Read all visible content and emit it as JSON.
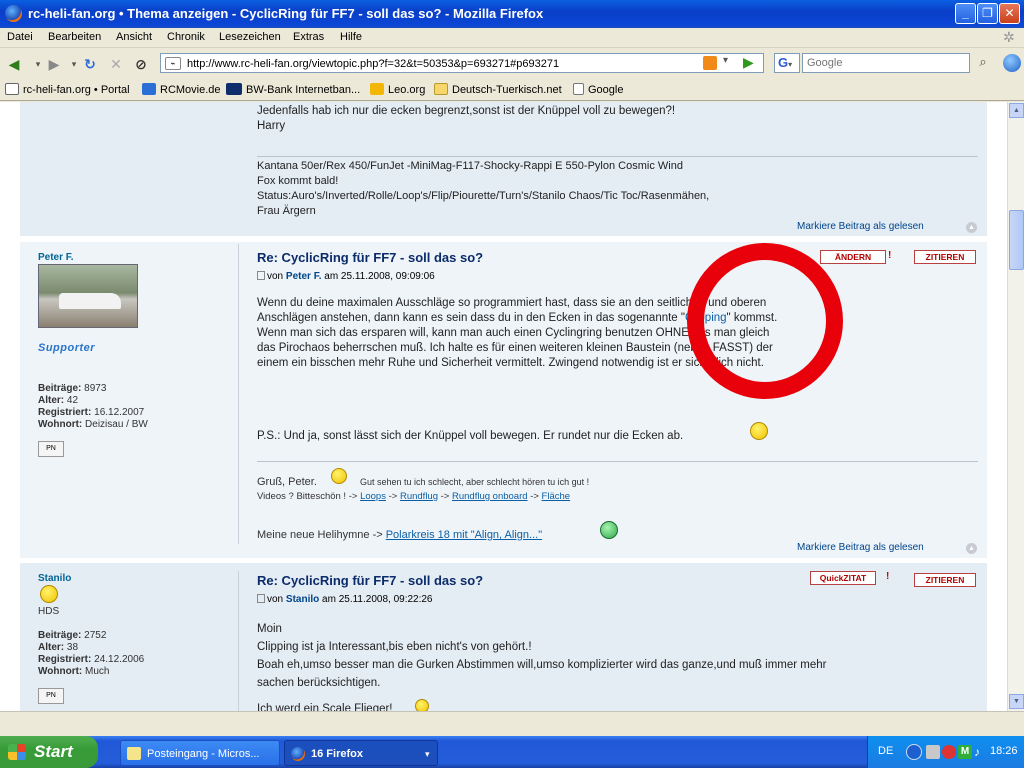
{
  "window": {
    "title": "rc-heli-fan.org • Thema anzeigen - CyclicRing für FF7 - soll das so? - Mozilla Firefox",
    "minimize_label": "_",
    "maximize_label": "❐",
    "close_label": "✕"
  },
  "menu": [
    "Datei",
    "Bearbeiten",
    "Ansicht",
    "Chronik",
    "Lesezeichen",
    "Extras",
    "Hilfe"
  ],
  "navigation": {
    "url": "http://www.rc-heli-fan.org/viewtopic.php?f=32&t=50353&p=693271#p693271",
    "search_engine": "G",
    "search_placeholder": "Google"
  },
  "bookmarks": [
    {
      "label": "rc-heli-fan.org • Portal",
      "icon": "heli-icon",
      "color": "#ffffff"
    },
    {
      "label": "RCMovie.de",
      "icon": "movie-icon",
      "color": "#2a6fd6"
    },
    {
      "label": "BW-Bank Internetban...",
      "icon": "bank-icon",
      "color": "#0d2d6b"
    },
    {
      "label": "Leo.org",
      "icon": "leo-icon",
      "color": "#f2b705"
    },
    {
      "label": "Deutsch-Tuerkisch.net",
      "icon": "folder-icon",
      "color": "#f7d66b"
    },
    {
      "label": "Google",
      "icon": "page-icon",
      "color": "#ffffff"
    }
  ],
  "first_post_tail": {
    "lines": [
      "Jedenfalls hab ich nur die ecken begrenzt,sonst ist der Knüppel voll zu bewegen?!",
      "Harry"
    ],
    "signature": [
      "Kantana 50er/Rex 450/FunJet -MiniMag-F117-Shocky-Rappi E 550-Pylon Cosmic Wind",
      "Fox kommt bald!",
      "Status:Auro's/Inverted/Rolle/Loop's/Flip/Piourette/Turn's/Stanilo Chaos/Tic Toc/Rasenmähen,",
      "Frau Ärgern"
    ],
    "mark_read": "Markiere Beitrag als gelesen"
  },
  "post_peter": {
    "username": "Peter F.",
    "rank_badge": "Supporter",
    "stats": {
      "beitraege": "8973",
      "alter": "42",
      "registriert": "16.12.2007",
      "wohnort": "Deizisau / BW"
    },
    "labels": {
      "beitraege": "Beiträge:",
      "alter": "Alter:",
      "registriert": "Registriert:",
      "wohnort": "Wohnort:"
    },
    "pm_label": "PN",
    "title": "Re: CyclicRing für FF7 - soll das so?",
    "meta_prefix": "von",
    "author": "Peter F.",
    "meta_date": "am 25.11.2008, 09:09:06",
    "buttons": {
      "edit": "ÄNDERN",
      "quote": "ZITIEREN"
    },
    "body": [
      "Wenn du deine maximalen Ausschläge so programmiert hast, dass sie an den seitlichen und oberen",
      "Anschlägen anstehen, dann kann es sein dass du in den Ecken in das sogenannte \"",
      "Wenn man sich das ersparen will, kann man auch einen Cyclingring benutzen OHNE das man gleich",
      "das Pirochaos beherrschen muß. Ich halte es für einen weiteren kleinen Baustein (neben FASST) der",
      "einem ein bisschen mehr Ruhe und Sicherheit vermittelt. Zwingend notwendig ist er sicherlich nicht."
    ],
    "clipping_word": "Clipping",
    "clipping_tail": "\" kommst.",
    "ps": "P.S.: Und ja, sonst lässt sich der Knüppel voll bewegen. Er rundet nur die Ecken ab.",
    "sig_greeting": "Gruß, Peter.",
    "sig_motto": "Gut sehen tu ich schlecht, aber schlecht hören tu ich gut !",
    "sig_videos_prefix": "Videos ? Bitteschön ! ->",
    "sig_links": [
      "Loops",
      "Rundflug",
      "Rundflug onboard",
      "Fläche"
    ],
    "sig_arrow": "->",
    "sig_hymn_prefix": "Meine neue Helihymne ->",
    "sig_hymn_link": "Polarkreis 18 mit \"Align, Align...\"",
    "mark_read": "Markiere Beitrag als gelesen"
  },
  "post_stanilo": {
    "username": "Stanilo",
    "rank": "HDS",
    "stats": {
      "beitraege": "2752",
      "alter": "38",
      "registriert": "24.12.2006",
      "wohnort": "Much"
    },
    "labels": {
      "beitraege": "Beiträge:",
      "alter": "Alter:",
      "registriert": "Registriert:",
      "wohnort": "Wohnort:"
    },
    "pm_label": "PN",
    "title": "Re: CyclicRing für FF7 - soll das so?",
    "meta_prefix": "von",
    "author": "Stanilo",
    "meta_date": "am 25.11.2008, 09:22:26",
    "buttons": {
      "quickquote": "QuickZITAT",
      "quote": "ZITIEREN"
    },
    "body": [
      "Moin",
      "Clipping ist ja Interessant,bis eben nicht's von gehört.!",
      "Boah eh,umso besser man die Gurken Abstimmen will,umso komplizierter wird das ganze,und muß immer mehr",
      "sachen berücksichtigen.",
      "Ich werd ein Scale Flieger!"
    ]
  },
  "taskbar": {
    "start_label": "Start",
    "items": [
      {
        "label": "Posteingang - Micros...",
        "icon": "outlook-icon"
      },
      {
        "label": "16 Firefox",
        "icon": "firefox-icon"
      }
    ],
    "language": "DE",
    "clock": "18:26"
  },
  "annotation_color": "#e8000a"
}
